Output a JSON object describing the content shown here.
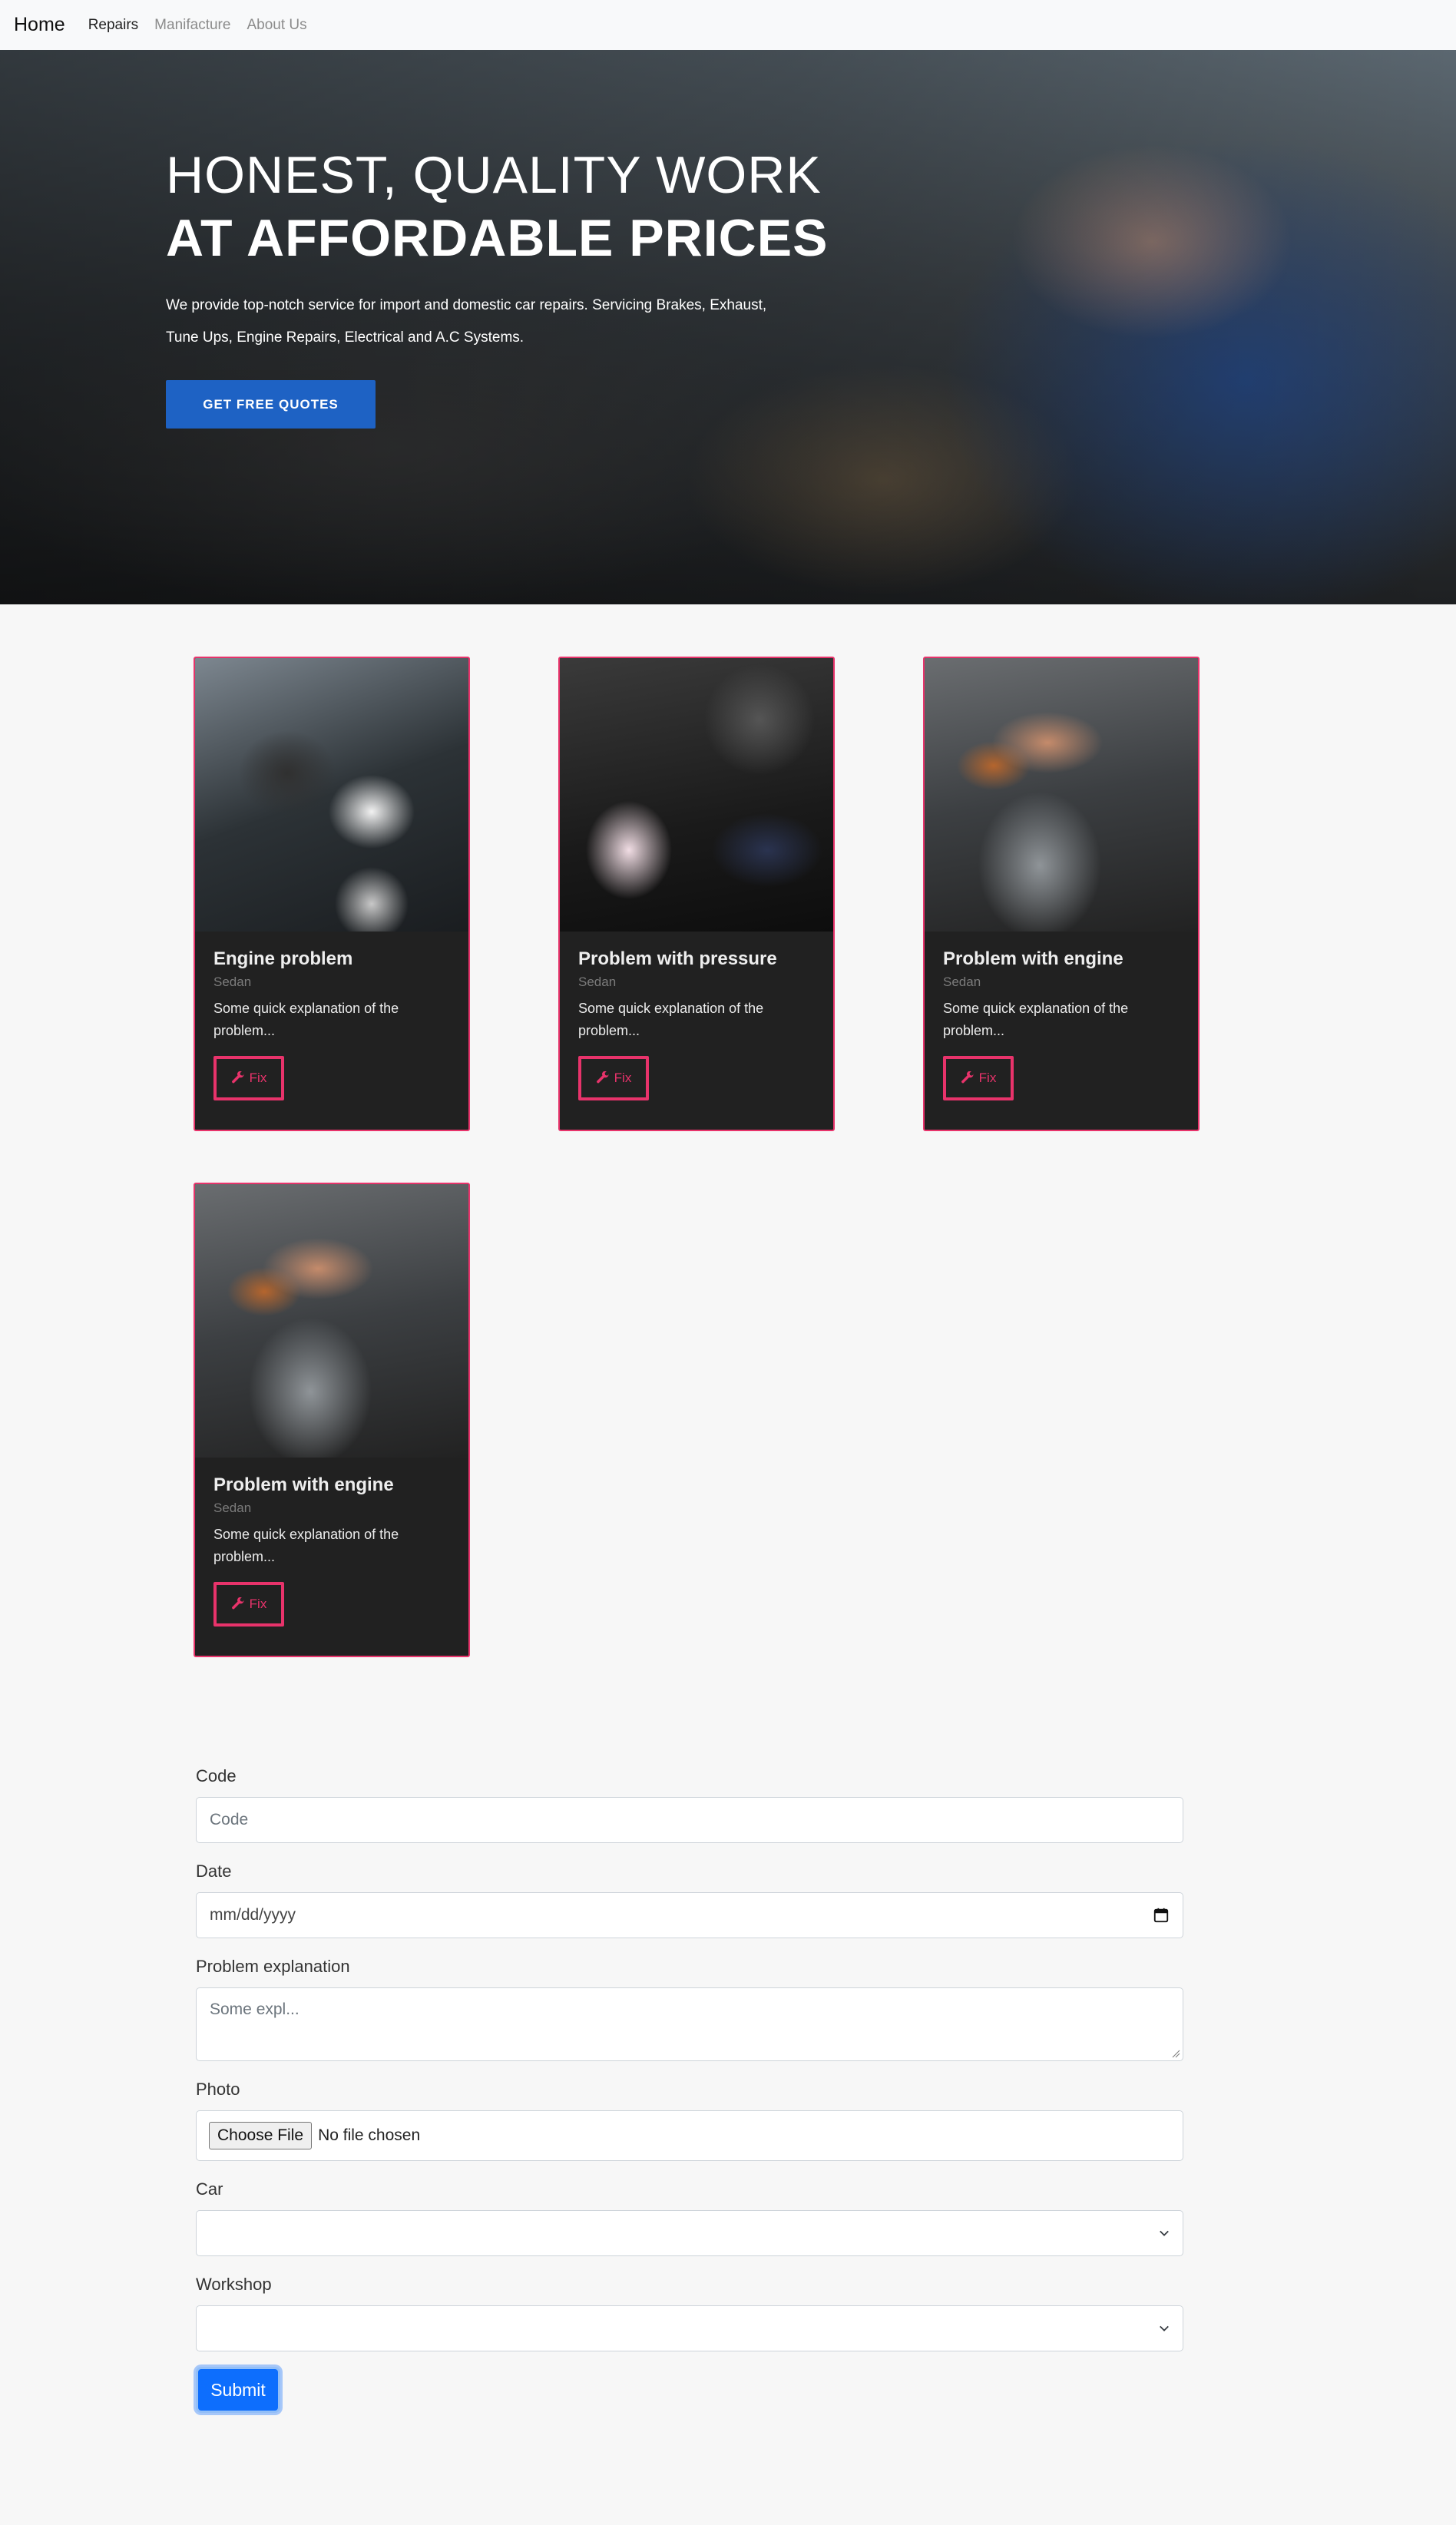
{
  "navbar": {
    "brand": "Home",
    "links": [
      "Repairs",
      "Manifacture",
      "About Us"
    ]
  },
  "hero": {
    "line1": "HONEST, QUALITY WORK",
    "line2": "AT AFFORDABLE PRICES",
    "description": "We provide top-notch service for import and domestic car repairs. Servicing Brakes, Exhaust, Tune Ups, Engine Repairs, Electrical and A.C Systems.",
    "cta_label": "GET FREE QUOTES"
  },
  "cards": [
    {
      "title": "Engine problem",
      "subtitle": "Sedan",
      "text": "Some quick explanation of the problem...",
      "button": "Fix",
      "image": "engine-bay-photo"
    },
    {
      "title": "Problem with pressure",
      "subtitle": "Sedan",
      "text": "Some quick explanation of the problem...",
      "button": "Fix",
      "image": "pressure-tester-photo"
    },
    {
      "title": "Problem with engine",
      "subtitle": "Sedan",
      "text": "Some quick explanation of the problem...",
      "button": "Fix",
      "image": "mechanic-wrench-photo"
    },
    {
      "title": "Problem with engine",
      "subtitle": "Sedan",
      "text": "Some quick explanation of the problem...",
      "button": "Fix",
      "image": "mechanic-wrench-photo"
    }
  ],
  "form": {
    "code_label": "Code",
    "code_placeholder": "Code",
    "date_label": "Date",
    "date_placeholder": "mm/dd/yyyy",
    "problem_label": "Problem explanation",
    "problem_placeholder": "Some expl...",
    "photo_label": "Photo",
    "choose_file": "Choose File",
    "no_file": "No file chosen",
    "car_label": "Car",
    "car_value": "",
    "workshop_label": "Workshop",
    "workshop_value": "",
    "submit_label": "Submit"
  },
  "colors": {
    "accent": "#e8336b",
    "hero_button": "#1e62c4",
    "submit": "#0d6efd",
    "card_bg": "#212121"
  }
}
